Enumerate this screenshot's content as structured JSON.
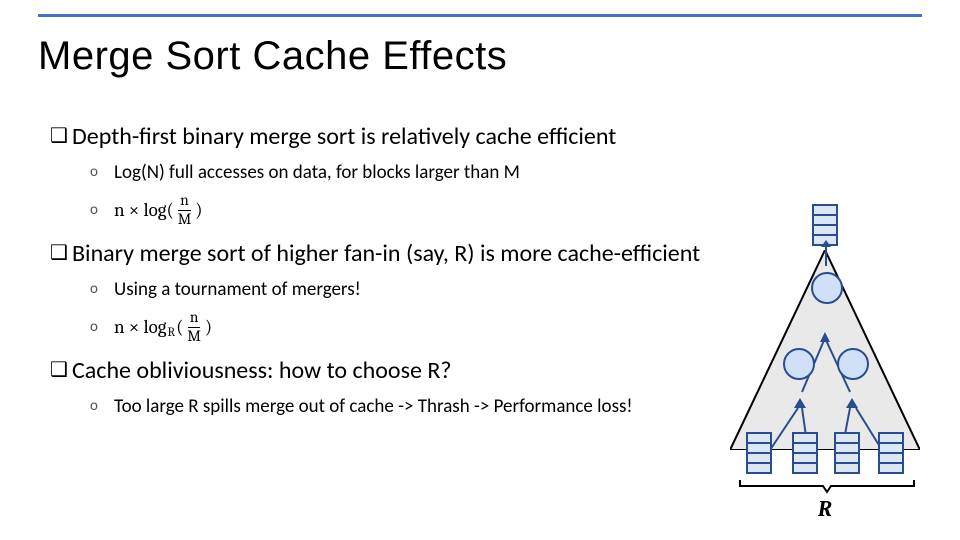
{
  "title": "Merge Sort Cache Effects",
  "bullets": {
    "b1": "Depth-first binary merge sort is relatively cache efficient",
    "b1a": "Log(N) full accesses on data, for blocks larger than M",
    "b1b_prefix": "n × log(",
    "b1b_num": "n",
    "b1b_den": "M",
    "b1b_suffix": ")",
    "b2": "Binary merge sort of higher fan-in (say, R) is more cache-efficient",
    "b2a": "Using a tournament of mergers!",
    "b2b_prefix": "n × log",
    "b2b_sub": "R",
    "b2b_open": "(",
    "b2b_num": "n",
    "b2b_den": "M",
    "b2b_suffix": ")",
    "b3": "Cache obliviousness: how to choose R?",
    "b3a": "Too large R spills merge out of cache -> Thrash -> Performance loss!"
  },
  "diagram": {
    "fanin_label": "R"
  }
}
